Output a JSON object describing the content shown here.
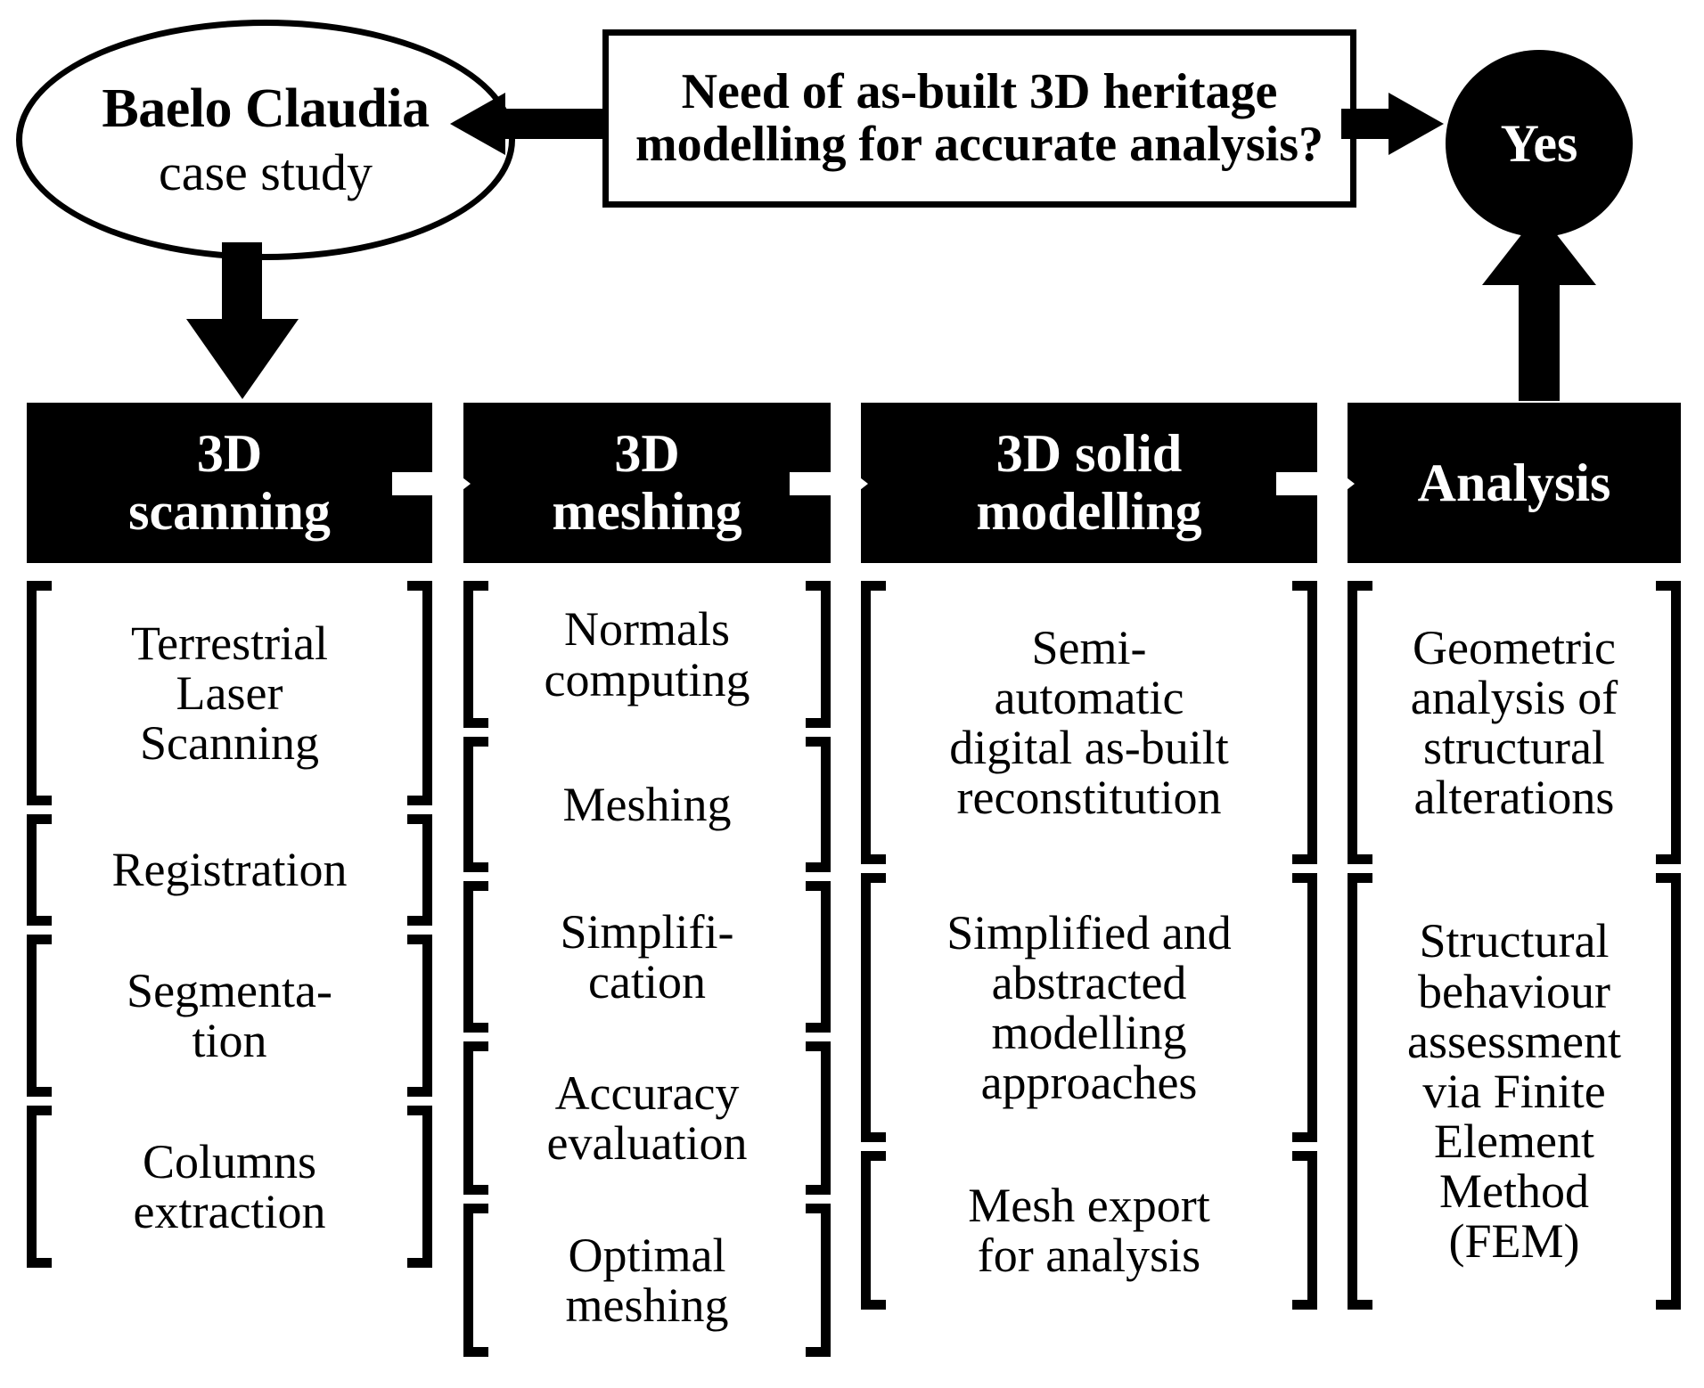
{
  "top_row": {
    "case_study_node": {
      "title": "Baelo Claudia",
      "subtitle": "case study"
    },
    "decision": {
      "question": "Need of as-built 3D heritage modelling for accurate analysis?"
    },
    "answer": {
      "label": "Yes"
    },
    "connectors": [
      {
        "name": "decision-to-case-study",
        "direction": "left"
      },
      {
        "name": "decision-to-yes",
        "direction": "right"
      },
      {
        "name": "case-study-to-3d-scanning",
        "direction": "down"
      },
      {
        "name": "analysis-to-yes",
        "direction": "up"
      }
    ]
  },
  "pipeline": {
    "stages": [
      {
        "label": "3D\nscanning",
        "line1": "3D",
        "line2": "scanning"
      },
      {
        "label": "3D\nmeshing",
        "line1": "3D",
        "line2": "meshing"
      },
      {
        "label": "3D solid\nmodelling",
        "line1": "3D solid",
        "line2": "modelling"
      },
      {
        "label": "Analysis",
        "line1": "Analysis",
        "line2": ""
      }
    ]
  },
  "columns": [
    {
      "stage": "3D scanning",
      "items": [
        {
          "lines": [
            "Terrestrial",
            "Laser",
            "Scanning"
          ],
          "text": "Terrestrial Laser Scanning"
        },
        {
          "lines": [
            "Registration"
          ],
          "text": "Registration"
        },
        {
          "lines": [
            "Segmenta-",
            "tion"
          ],
          "text": "Segmenta-tion"
        },
        {
          "lines": [
            "Columns",
            "extraction"
          ],
          "text": "Columns extraction"
        }
      ]
    },
    {
      "stage": "3D meshing",
      "items": [
        {
          "lines": [
            "Normals",
            "computing"
          ],
          "text": "Normals computing"
        },
        {
          "lines": [
            "Meshing"
          ],
          "text": "Meshing"
        },
        {
          "lines": [
            "Simplifi-",
            "cation"
          ],
          "text": "Simplifi-cation"
        },
        {
          "lines": [
            "Accuracy",
            "evaluation"
          ],
          "text": "Accuracy evaluation"
        },
        {
          "lines": [
            "Optimal",
            "meshing"
          ],
          "text": "Optimal meshing"
        }
      ]
    },
    {
      "stage": "3D solid modelling",
      "items": [
        {
          "lines": [
            "Semi-",
            "automatic",
            "digital as-built",
            "reconstitution"
          ],
          "text": "Semi-automatic digital as-built reconstitution"
        },
        {
          "lines": [
            "Simplified and",
            "abstracted",
            "modelling",
            "approaches"
          ],
          "text": "Simplified and abstracted modelling approaches"
        },
        {
          "lines": [
            "Mesh export",
            "for analysis"
          ],
          "text": "Mesh export for analysis"
        }
      ]
    },
    {
      "stage": "Analysis",
      "items": [
        {
          "lines": [
            "Geometric",
            "analysis of",
            "structural",
            "alterations"
          ],
          "text": "Geometric analysis of structural alterations"
        },
        {
          "lines": [
            "Structural",
            "behaviour",
            "assessment",
            "via Finite",
            "Element",
            "Method",
            "(FEM)"
          ],
          "text": "Structural behaviour assessment via Finite Element Method (FEM)"
        }
      ]
    }
  ],
  "colors": {
    "foreground": "#000000",
    "background": "#ffffff",
    "stage_box_fill": "#000000",
    "stage_box_text": "#ffffff"
  }
}
